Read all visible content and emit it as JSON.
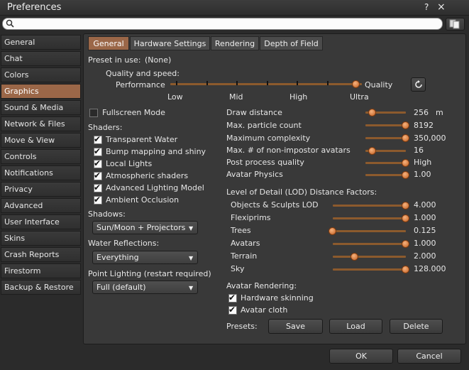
{
  "window": {
    "title": "Preferences",
    "help_glyph": "?",
    "close_glyph": "×"
  },
  "search": {
    "value": "",
    "placeholder": ""
  },
  "sidebar": {
    "items": [
      {
        "label": "General"
      },
      {
        "label": "Chat"
      },
      {
        "label": "Colors"
      },
      {
        "label": "Graphics"
      },
      {
        "label": "Sound & Media"
      },
      {
        "label": "Network & Files"
      },
      {
        "label": "Move & View"
      },
      {
        "label": "Controls"
      },
      {
        "label": "Notifications"
      },
      {
        "label": "Privacy"
      },
      {
        "label": "Advanced"
      },
      {
        "label": "User Interface"
      },
      {
        "label": "Skins"
      },
      {
        "label": "Crash Reports"
      },
      {
        "label": "Firestorm"
      },
      {
        "label": "Backup & Restore"
      }
    ],
    "active_index": 3
  },
  "tabs": [
    {
      "label": "General"
    },
    {
      "label": "Hardware Settings"
    },
    {
      "label": "Rendering"
    },
    {
      "label": "Depth of Field"
    }
  ],
  "preset": {
    "label": "Preset in use:",
    "value": "(None)"
  },
  "quality": {
    "title": "Quality and speed:",
    "left_label": "Performance",
    "right_label": "Quality",
    "ticks": [
      "Low",
      "Mid",
      "High",
      "Ultra"
    ],
    "level_fraction": 1.0
  },
  "fullscreen": {
    "label": "Fullscreen Mode",
    "checked": false
  },
  "shaders": {
    "title": "Shaders:",
    "items": [
      {
        "label": "Transparent Water",
        "checked": true
      },
      {
        "label": "Bump mapping and shiny",
        "checked": true
      },
      {
        "label": "Local Lights",
        "checked": true
      },
      {
        "label": "Atmospheric shaders",
        "checked": true
      },
      {
        "label": "Advanced Lighting Model",
        "checked": true
      },
      {
        "label": "Ambient Occlusion",
        "checked": true
      }
    ]
  },
  "shadows": {
    "title": "Shadows:",
    "selected": "Sun/Moon + Projectors"
  },
  "water": {
    "title": "Water Reflections:",
    "selected": "Everything"
  },
  "point_lighting": {
    "title": "Point Lighting (restart required)",
    "selected": "Full (default)"
  },
  "right_settings": [
    {
      "label": "Draw distance",
      "value": "256",
      "unit": "m",
      "fraction": 0.18
    },
    {
      "label": "Max. particle count",
      "value": "8192",
      "fraction": 1.0
    },
    {
      "label": "Maximum complexity",
      "value": "350,000",
      "fraction": 1.0
    },
    {
      "label": "Max. # of non-impostor avatars",
      "value": "16",
      "fraction": 0.18
    },
    {
      "label": "Post process quality",
      "value": "High",
      "fraction": 1.0
    },
    {
      "label": "Avatar Physics",
      "value": "1.00",
      "fraction": 1.0
    }
  ],
  "lod": {
    "title": "Level of Detail (LOD) Distance Factors:",
    "items": [
      {
        "label": "Objects & Sculpts LOD",
        "value": "4.000",
        "fraction": 1.0
      },
      {
        "label": "Flexiprims",
        "value": "1.000",
        "fraction": 1.0
      },
      {
        "label": "Trees",
        "value": "0.125",
        "fraction": 0.0
      },
      {
        "label": "Avatars",
        "value": "1.000",
        "fraction": 1.0
      },
      {
        "label": "Terrain",
        "value": "2.000",
        "fraction": 0.3
      },
      {
        "label": "Sky",
        "value": "128.000",
        "fraction": 1.0
      }
    ]
  },
  "avatar_rendering": {
    "title": "Avatar Rendering:",
    "items": [
      {
        "label": "Hardware skinning",
        "checked": true
      },
      {
        "label": "Avatar cloth",
        "checked": true
      }
    ]
  },
  "presets": {
    "label": "Presets:",
    "save": "Save",
    "load": "Load",
    "delete": "Delete"
  },
  "footer": {
    "ok": "OK",
    "cancel": "Cancel"
  },
  "colors": {
    "accent": "#9b6748",
    "slider": "#d9783a",
    "panel": "#393939",
    "background": "#2b2b2b"
  },
  "glyphs": {
    "check": "✔",
    "dropdown_arrow": "▼"
  }
}
